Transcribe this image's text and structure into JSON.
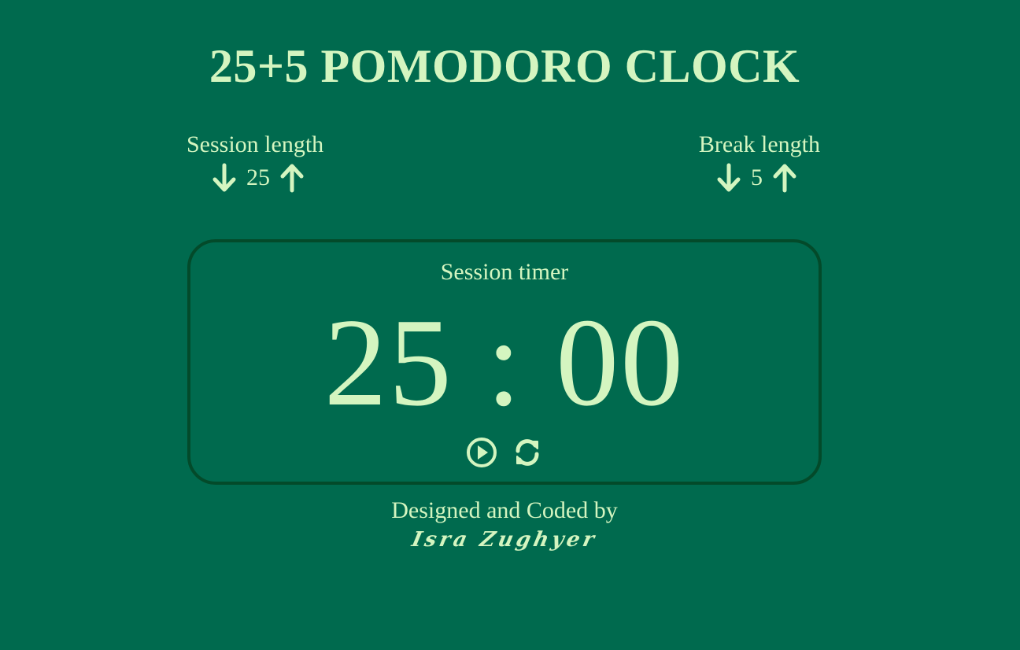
{
  "header": {
    "title": "25+5 POMODORO CLOCK"
  },
  "session_control": {
    "label": "Session length",
    "value": "25",
    "decrement_icon": "arrow-down-icon",
    "increment_icon": "arrow-up-icon"
  },
  "break_control": {
    "label": "Break length",
    "value": "5",
    "decrement_icon": "arrow-down-icon",
    "increment_icon": "arrow-up-icon"
  },
  "timer": {
    "label": "Session timer",
    "display": "25 : 00",
    "play_icon": "play-circle-icon",
    "reset_icon": "refresh-icon"
  },
  "footer": {
    "credit_text": "Designed and Coded by",
    "author": "Isra Zughyer"
  },
  "colors": {
    "background": "#006a4e",
    "text": "#d4f5c0",
    "border": "#034a2a"
  }
}
